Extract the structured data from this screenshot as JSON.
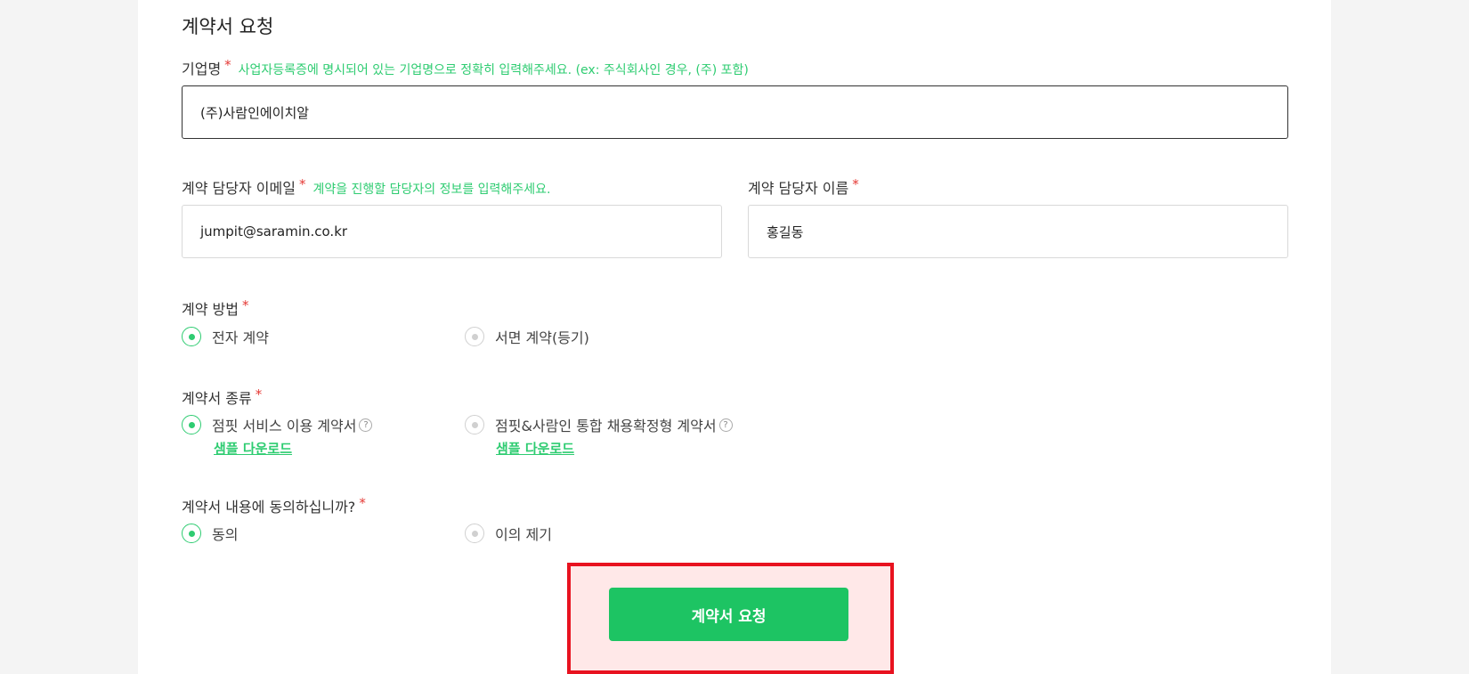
{
  "section_title": "계약서 요청",
  "company": {
    "label": "기업명",
    "required_mark": "*",
    "hint": "사업자등록증에 명시되어 있는 기업명으로 정확히 입력해주세요. (ex: 주식회사인 경우, (주) 포함)",
    "value": "(주)사람인에이치알"
  },
  "email": {
    "label": "계약 담당자 이메일",
    "required_mark": "*",
    "hint": "계약을 진행할 담당자의 정보를 입력해주세요.",
    "value": "jumpit@saramin.co.kr"
  },
  "name": {
    "label": "계약 담당자 이름",
    "required_mark": "*",
    "value": "홍길동"
  },
  "method": {
    "label": "계약 방법",
    "required_mark": "*",
    "options": [
      "전자 계약",
      "서면 계약(등기)"
    ],
    "selected": 0
  },
  "contract_type": {
    "label": "계약서 종류",
    "required_mark": "*",
    "options": [
      "점핏 서비스 이용 계약서",
      "점핏&사람인 통합 채용확정형 계약서"
    ],
    "help_icon": "?",
    "sample_link": "샘플 다운로드",
    "selected": 0
  },
  "agree": {
    "label": "계약서 내용에 동의하십니까?",
    "required_mark": "*",
    "options": [
      "동의",
      "이의 제기"
    ],
    "selected": 0
  },
  "submit_label": "계약서 요청",
  "colors": {
    "accent": "#2ecc71",
    "button": "#1dc463",
    "required": "#e53935",
    "highlight_border": "#e8121f",
    "highlight_fill": "#ffe8e8"
  }
}
